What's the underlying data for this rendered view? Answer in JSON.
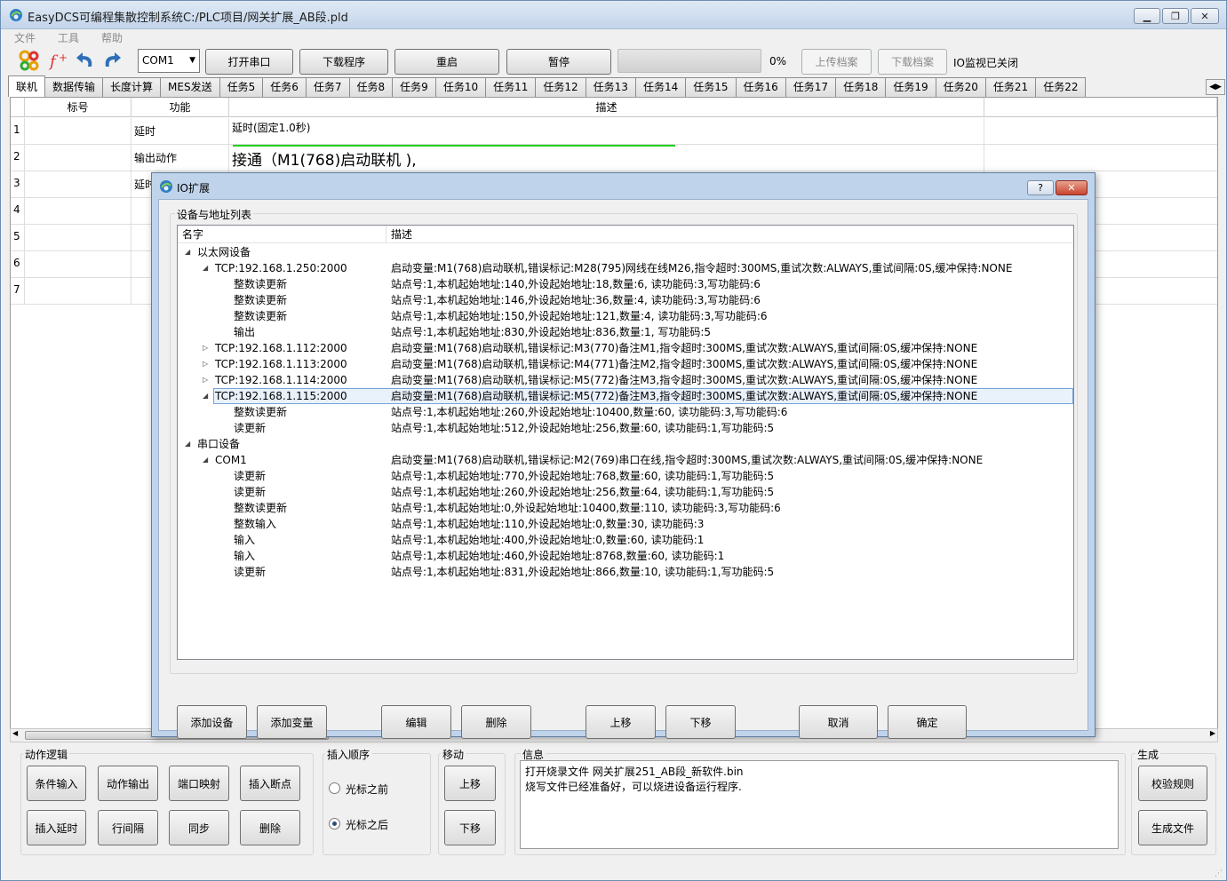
{
  "window": {
    "title": "EasyDCS可编程集散控制系统C:/PLC项目/网关扩展_AB段.pld"
  },
  "menu": [
    "文件",
    "工具",
    "帮助"
  ],
  "toolbar": {
    "port": "COM1",
    "open_port": "打开串口",
    "download": "下载程序",
    "restart": "重启",
    "pause": "暂停",
    "progress_text": "0%",
    "progress_value": 0,
    "upload_archive": "上传档案",
    "download_archive": "下载档案",
    "io_status": "IO监视已关闭"
  },
  "tabs": [
    "联机",
    "数据传输",
    "长度计算",
    "MES发送",
    "任务5",
    "任务6",
    "任务7",
    "任务8",
    "任务9",
    "任务10",
    "任务11",
    "任务12",
    "任务13",
    "任务14",
    "任务15",
    "任务16",
    "任务17",
    "任务18",
    "任务19",
    "任务20",
    "任务21",
    "任务22"
  ],
  "grid": {
    "headers": [
      "标号",
      "功能",
      "描述"
    ],
    "rows": [
      {
        "num": "1",
        "label": "",
        "func": "延时",
        "desc": "延时(固定1.0秒)"
      },
      {
        "num": "2",
        "label": "",
        "func": "输出动作",
        "desc": "接通（M1(768)启动联机 ),"
      },
      {
        "num": "3",
        "label": "",
        "func": "延时",
        "desc": ""
      },
      {
        "num": "4",
        "label": "",
        "func": "",
        "desc": ""
      },
      {
        "num": "5",
        "label": "",
        "func": "",
        "desc": ""
      },
      {
        "num": "6",
        "label": "",
        "func": "",
        "desc": ""
      },
      {
        "num": "7",
        "label": "",
        "func": "",
        "desc": ""
      }
    ]
  },
  "bottom": {
    "action_logic": {
      "title": "动作逻辑",
      "buttons": [
        "条件输入",
        "动作输出",
        "端口映射",
        "插入断点",
        "插入延时",
        "行间隔",
        "同步",
        "删除"
      ]
    },
    "insert_order": {
      "title": "插入顺序",
      "before": "光标之前",
      "after": "光标之后",
      "selected": "after"
    },
    "move": {
      "title": "移动",
      "up": "上移",
      "down": "下移"
    },
    "info": {
      "title": "信息",
      "lines": [
        "打开烧录文件 网关扩展251_AB段_新软件.bin",
        "烧写文件已经准备好，可以烧进设备运行程序."
      ]
    },
    "generate": {
      "title": "生成",
      "check": "校验规则",
      "gen_file": "生成文件"
    }
  },
  "dialog": {
    "title": "IO扩展",
    "help": "?",
    "group_title": "设备与地址列表",
    "columns": [
      "名字",
      "描述"
    ],
    "tree": [
      {
        "level": 0,
        "exp": "open",
        "name": "以太网设备",
        "desc": ""
      },
      {
        "level": 1,
        "exp": "open",
        "name": "TCP:192.168.1.250:2000",
        "desc": "启动变量:M1(768)启动联机,错误标记:M28(795)网线在线M26,指令超时:300MS,重试次数:ALWAYS,重试间隔:0S,缓冲保持:NONE"
      },
      {
        "level": 2,
        "exp": "",
        "name": "整数读更新",
        "desc": "站点号:1,本机起始地址:140,外设起始地址:18,数量:6, 读功能码:3,写功能码:6"
      },
      {
        "level": 2,
        "exp": "",
        "name": "整数读更新",
        "desc": "站点号:1,本机起始地址:146,外设起始地址:36,数量:4, 读功能码:3,写功能码:6"
      },
      {
        "level": 2,
        "exp": "",
        "name": "整数读更新",
        "desc": "站点号:1,本机起始地址:150,外设起始地址:121,数量:4, 读功能码:3,写功能码:6"
      },
      {
        "level": 2,
        "exp": "",
        "name": "输出",
        "desc": "站点号:1,本机起始地址:830,外设起始地址:836,数量:1, 写功能码:5"
      },
      {
        "level": 1,
        "exp": "closed",
        "name": "TCP:192.168.1.112:2000",
        "desc": "启动变量:M1(768)启动联机,错误标记:M3(770)备注M1,指令超时:300MS,重试次数:ALWAYS,重试间隔:0S,缓冲保持:NONE"
      },
      {
        "level": 1,
        "exp": "closed",
        "name": "TCP:192.168.1.113:2000",
        "desc": "启动变量:M1(768)启动联机,错误标记:M4(771)备注M2,指令超时:300MS,重试次数:ALWAYS,重试间隔:0S,缓冲保持:NONE"
      },
      {
        "level": 1,
        "exp": "closed",
        "name": "TCP:192.168.1.114:2000",
        "desc": "启动变量:M1(768)启动联机,错误标记:M5(772)备注M3,指令超时:300MS,重试次数:ALWAYS,重试间隔:0S,缓冲保持:NONE"
      },
      {
        "level": 1,
        "exp": "open",
        "name": "TCP:192.168.1.115:2000",
        "desc": "启动变量:M1(768)启动联机,错误标记:M5(772)备注M3,指令超时:300MS,重试次数:ALWAYS,重试间隔:0S,缓冲保持:NONE",
        "selected": true
      },
      {
        "level": 2,
        "exp": "",
        "name": "整数读更新",
        "desc": "站点号:1,本机起始地址:260,外设起始地址:10400,数量:60, 读功能码:3,写功能码:6"
      },
      {
        "level": 2,
        "exp": "",
        "name": "读更新",
        "desc": "站点号:1,本机起始地址:512,外设起始地址:256,数量:60, 读功能码:1,写功能码:5"
      },
      {
        "level": 0,
        "exp": "open",
        "name": "串口设备",
        "desc": ""
      },
      {
        "level": 1,
        "exp": "open",
        "name": "COM1",
        "desc": "启动变量:M1(768)启动联机,错误标记:M2(769)串口在线,指令超时:300MS,重试次数:ALWAYS,重试间隔:0S,缓冲保持:NONE"
      },
      {
        "level": 2,
        "exp": "",
        "name": "读更新",
        "desc": "站点号:1,本机起始地址:770,外设起始地址:768,数量:60, 读功能码:1,写功能码:5"
      },
      {
        "level": 2,
        "exp": "",
        "name": "读更新",
        "desc": "站点号:1,本机起始地址:260,外设起始地址:256,数量:64, 读功能码:1,写功能码:5"
      },
      {
        "level": 2,
        "exp": "",
        "name": "整数读更新",
        "desc": "站点号:1,本机起始地址:0,外设起始地址:10400,数量:110, 读功能码:3,写功能码:6"
      },
      {
        "level": 2,
        "exp": "",
        "name": "整数输入",
        "desc": "站点号:1,本机起始地址:110,外设起始地址:0,数量:30, 读功能码:3"
      },
      {
        "level": 2,
        "exp": "",
        "name": "输入",
        "desc": "站点号:1,本机起始地址:400,外设起始地址:0,数量:60, 读功能码:1"
      },
      {
        "level": 2,
        "exp": "",
        "name": "输入",
        "desc": "站点号:1,本机起始地址:460,外设起始地址:8768,数量:60, 读功能码:1"
      },
      {
        "level": 2,
        "exp": "",
        "name": "读更新",
        "desc": "站点号:1,本机起始地址:831,外设起始地址:866,数量:10, 读功能码:1,写功能码:5"
      }
    ],
    "buttons": {
      "add_device": "添加设备",
      "add_var": "添加变量",
      "edit": "编辑",
      "delete": "删除",
      "up": "上移",
      "down": "下移",
      "cancel": "取消",
      "ok": "确定"
    }
  }
}
